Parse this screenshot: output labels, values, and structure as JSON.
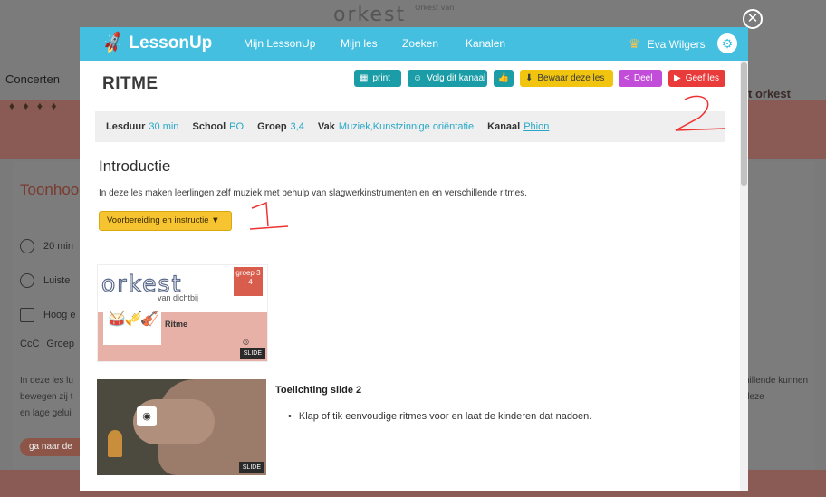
{
  "background": {
    "logo": "orkest",
    "logo_sub": "Orkest van",
    "nav_item": "Concerten",
    "side_title": "Toonhoo",
    "rows": [
      "20 min",
      "Luiste",
      "Hoog e",
      "Groep"
    ],
    "para_left": "In deze les lu bewegen zij t en lage gelui",
    "para_right": "hillende kunnen deze",
    "button": "ga naar de",
    "orkest_label": "t orkest"
  },
  "header": {
    "logo": "LessonUp",
    "nav": [
      "Mijn LessonUp",
      "Mijn les",
      "Zoeken",
      "Kanalen"
    ],
    "user": "Eva Wilgers"
  },
  "lesson": {
    "title": "RITME",
    "buttons": {
      "print": "print",
      "volg": "Volg dit kanaal",
      "bewaar": "Bewaar deze les",
      "deel": "Deel",
      "geef": "Geef les"
    },
    "meta": {
      "lesduur_label": "Lesduur",
      "lesduur": "30 min",
      "school_label": "School",
      "school": "PO",
      "groep_label": "Groep",
      "groep": "3,4",
      "vak_label": "Vak",
      "vak": "Muziek,Kunstzinnige oriëntatie",
      "kanaal_label": "Kanaal",
      "kanaal": "Phion"
    },
    "intro_heading": "Introductie",
    "intro_text": "In deze les maken leerlingen zelf muziek met behulp van slagwerkinstrumenten en en verschillende ritmes.",
    "prep_button": "Voorbereiding en instructie ▼"
  },
  "slides": [
    {
      "thumb_title": "orkest",
      "thumb_sub": "van dichtbij",
      "thumb_group": "groep 3 - 4",
      "thumb_label": "Ritme",
      "tag": "SLIDE"
    },
    {
      "title": "Toelichting slide 2",
      "bullet": "Klap of tik eenvoudige ritmes voor en laat de kinderen dat nadoen.",
      "tag": "SLIDE"
    }
  ],
  "annotations": [
    "1",
    "2"
  ]
}
